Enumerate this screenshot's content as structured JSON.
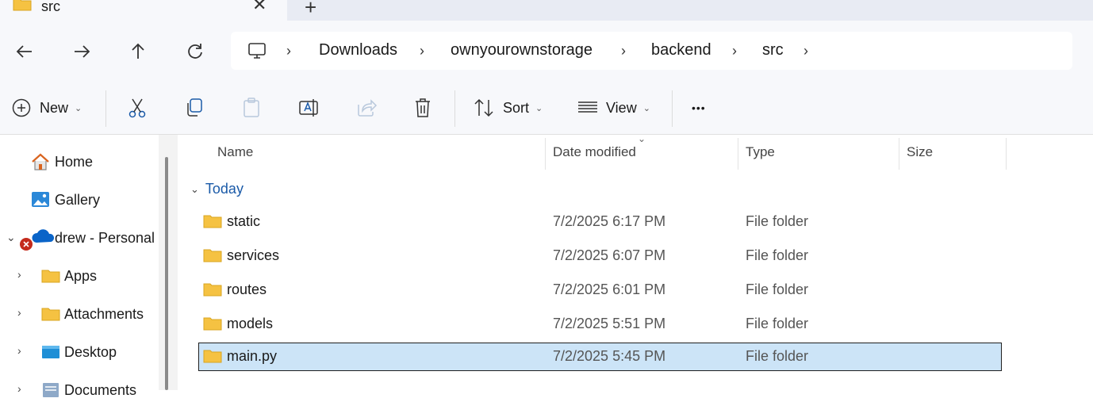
{
  "tab": {
    "title": "src",
    "close_glyph": "✕",
    "new_tab_glyph": "+"
  },
  "breadcrumb": [
    "Downloads",
    "ownyourownstorage",
    "backend",
    "src"
  ],
  "command_bar": {
    "new_label": "New",
    "sort_label": "Sort",
    "view_label": "View",
    "more_glyph": "•••"
  },
  "sidebar": {
    "items": [
      {
        "label": "Home",
        "icon": "home-icon"
      },
      {
        "label": "Gallery",
        "icon": "gallery-icon"
      },
      {
        "label": "drew - Personal",
        "icon": "onedrive-icon"
      },
      {
        "label": "Apps",
        "icon": "folder-icon"
      },
      {
        "label": "Attachments",
        "icon": "folder-icon"
      },
      {
        "label": "Desktop",
        "icon": "desktop-icon"
      },
      {
        "label": "Documents",
        "icon": "documents-icon"
      }
    ]
  },
  "columns": {
    "name": "Name",
    "date": "Date modified",
    "type": "Type",
    "size": "Size"
  },
  "group_label": "Today",
  "files": [
    {
      "name": "static",
      "date": "7/2/2025 6:17 PM",
      "type": "File folder"
    },
    {
      "name": "services",
      "date": "7/2/2025 6:07 PM",
      "type": "File folder"
    },
    {
      "name": "routes",
      "date": "7/2/2025 6:01 PM",
      "type": "File folder"
    },
    {
      "name": "models",
      "date": "7/2/2025 5:51 PM",
      "type": "File folder"
    },
    {
      "name": "main.py",
      "date": "7/2/2025 5:45 PM",
      "type": "File folder"
    }
  ],
  "colors": {
    "accent": "#1a5aa8",
    "selection": "#cce4f7",
    "folder": "#f5c242"
  }
}
